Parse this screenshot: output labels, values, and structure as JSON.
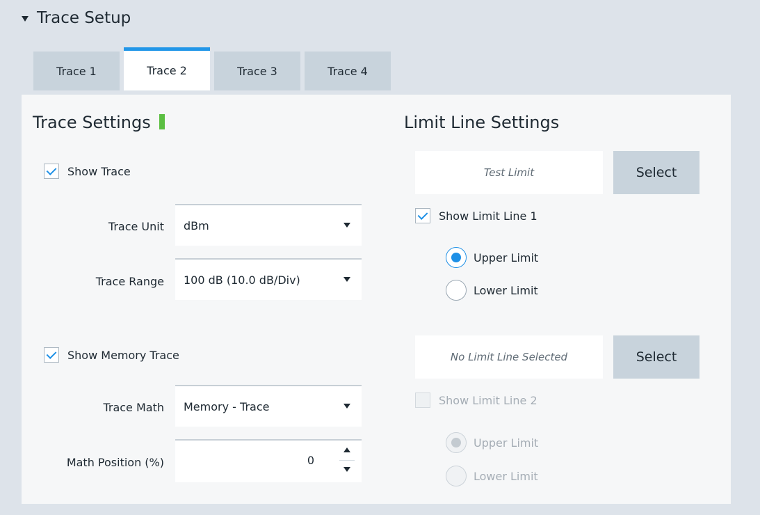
{
  "section": {
    "title": "Trace Setup"
  },
  "tabs": [
    {
      "label": "Trace 1",
      "active": false
    },
    {
      "label": "Trace 2",
      "active": true
    },
    {
      "label": "Trace 3",
      "active": false
    },
    {
      "label": "Trace 4",
      "active": false
    }
  ],
  "trace_settings": {
    "heading": "Trace Settings",
    "status_color": "#5bbf42",
    "show_trace": {
      "label": "Show Trace",
      "checked": true
    },
    "trace_unit": {
      "label": "Trace Unit",
      "value": "dBm"
    },
    "trace_range": {
      "label": "Trace Range",
      "value": "100 dB (10.0 dB/Div)"
    },
    "show_memory_trace": {
      "label": "Show Memory Trace",
      "checked": true
    },
    "trace_math": {
      "label": "Trace Math",
      "value": "Memory - Trace"
    },
    "math_position": {
      "label": "Math Position (%)",
      "value": "0"
    }
  },
  "limit_settings": {
    "heading": "Limit Line Settings",
    "limit1": {
      "name": "Test Limit",
      "select_label": "Select",
      "show_label": "Show Limit Line 1",
      "checked": true,
      "upper_label": "Upper Limit",
      "lower_label": "Lower Limit",
      "selected": "upper"
    },
    "limit2": {
      "name": "No Limit Line Selected",
      "select_label": "Select",
      "show_label": "Show Limit Line 2",
      "checked": false,
      "disabled": true,
      "upper_label": "Upper Limit",
      "lower_label": "Lower Limit",
      "selected": "upper"
    }
  },
  "colors": {
    "accent": "#1e90e6",
    "active_tab_border": "#2196e8"
  }
}
